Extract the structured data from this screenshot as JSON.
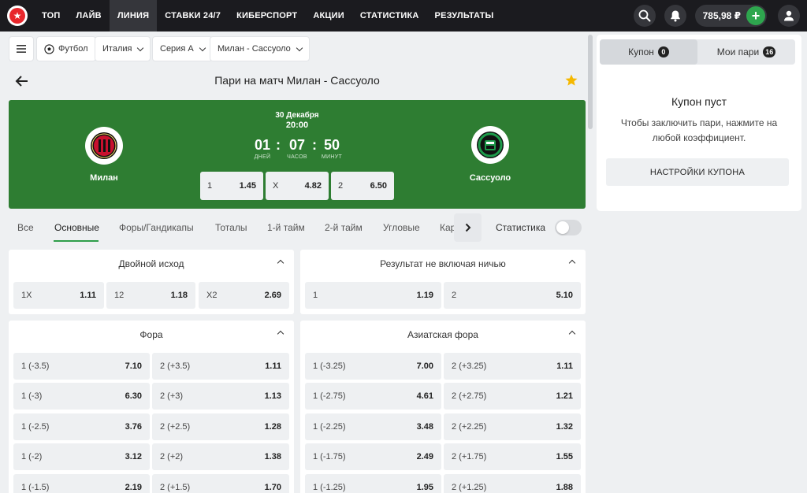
{
  "nav": {
    "items": [
      {
        "label": "ТОП"
      },
      {
        "label": "ЛАЙВ"
      },
      {
        "label": "ЛИНИЯ"
      },
      {
        "label": "СТАВКИ 24/7"
      },
      {
        "label": "КИБЕРСПОРТ"
      },
      {
        "label": "АКЦИИ"
      },
      {
        "label": "СТАТИСТИКА"
      },
      {
        "label": "РЕЗУЛЬТАТЫ"
      }
    ],
    "active": "ЛИНИЯ",
    "balance": "785,98 ₽"
  },
  "filters": {
    "sport": "Футбол",
    "country": "Италия",
    "league": "Серия А",
    "match": "Милан - Сассуоло"
  },
  "page": {
    "title": "Пари на матч Милан - Сассуоло"
  },
  "match": {
    "date": "30 Декабря",
    "time": "20:00",
    "home": "Милан",
    "away": "Сассуоло",
    "countdown": {
      "days": "01",
      "days_label": "ДНЕЙ",
      "hours": "07",
      "hours_label": "ЧАСОВ",
      "minutes": "50",
      "minutes_label": "МИНУТ"
    },
    "odds": [
      {
        "label": "1",
        "value": "1.45"
      },
      {
        "label": "X",
        "value": "4.82"
      },
      {
        "label": "2",
        "value": "6.50"
      }
    ]
  },
  "tabs": {
    "items": [
      {
        "label": "Все"
      },
      {
        "label": "Основные"
      },
      {
        "label": "Форы/Гандикапы"
      },
      {
        "label": "Тоталы"
      },
      {
        "label": "1-й тайм"
      },
      {
        "label": "2-й тайм"
      },
      {
        "label": "Угловые"
      },
      {
        "label": "Карточки"
      }
    ],
    "active": "Основные",
    "stats_label": "Статистика"
  },
  "markets": {
    "double_chance": {
      "title": "Двойной исход",
      "odds": [
        {
          "label": "1X",
          "value": "1.11"
        },
        {
          "label": "12",
          "value": "1.18"
        },
        {
          "label": "X2",
          "value": "2.69"
        }
      ]
    },
    "no_draw": {
      "title": "Результат не включая ничью",
      "odds": [
        {
          "label": "1",
          "value": "1.19"
        },
        {
          "label": "2",
          "value": "5.10"
        }
      ]
    },
    "handicap": {
      "title": "Фора",
      "rows": [
        [
          {
            "label": "1 (-3.5)",
            "value": "7.10"
          },
          {
            "label": "2 (+3.5)",
            "value": "1.11"
          }
        ],
        [
          {
            "label": "1 (-3)",
            "value": "6.30"
          },
          {
            "label": "2 (+3)",
            "value": "1.13"
          }
        ],
        [
          {
            "label": "1 (-2.5)",
            "value": "3.76"
          },
          {
            "label": "2 (+2.5)",
            "value": "1.28"
          }
        ],
        [
          {
            "label": "1 (-2)",
            "value": "3.12"
          },
          {
            "label": "2 (+2)",
            "value": "1.38"
          }
        ],
        [
          {
            "label": "1 (-1.5)",
            "value": "2.19"
          },
          {
            "label": "2 (+1.5)",
            "value": "1.70"
          }
        ]
      ]
    },
    "asian_handicap": {
      "title": "Азиатская фора",
      "rows": [
        [
          {
            "label": "1 (-3.25)",
            "value": "7.00"
          },
          {
            "label": "2 (+3.25)",
            "value": "1.11"
          }
        ],
        [
          {
            "label": "1 (-2.75)",
            "value": "4.61"
          },
          {
            "label": "2 (+2.75)",
            "value": "1.21"
          }
        ],
        [
          {
            "label": "1 (-2.25)",
            "value": "3.48"
          },
          {
            "label": "2 (+2.25)",
            "value": "1.32"
          }
        ],
        [
          {
            "label": "1 (-1.75)",
            "value": "2.49"
          },
          {
            "label": "2 (+1.75)",
            "value": "1.55"
          }
        ],
        [
          {
            "label": "1 (-1.25)",
            "value": "1.95"
          },
          {
            "label": "2 (+1.25)",
            "value": "1.88"
          }
        ]
      ]
    }
  },
  "coupon": {
    "tab_coupon": "Купон",
    "tab_coupon_count": "0",
    "tab_my_bets": "Мои пари",
    "tab_my_bets_count": "16",
    "empty_title": "Купон пуст",
    "empty_hint": "Чтобы заключить пари, нажмите на любой коэффициент.",
    "settings_button": "НАСТРОЙКИ КУПОНА"
  },
  "colors": {
    "nav_bg": "#1b1b1f",
    "banner_green": "#2e7d32",
    "accent_green": "#2e9e4a",
    "star": "#f5b800"
  }
}
